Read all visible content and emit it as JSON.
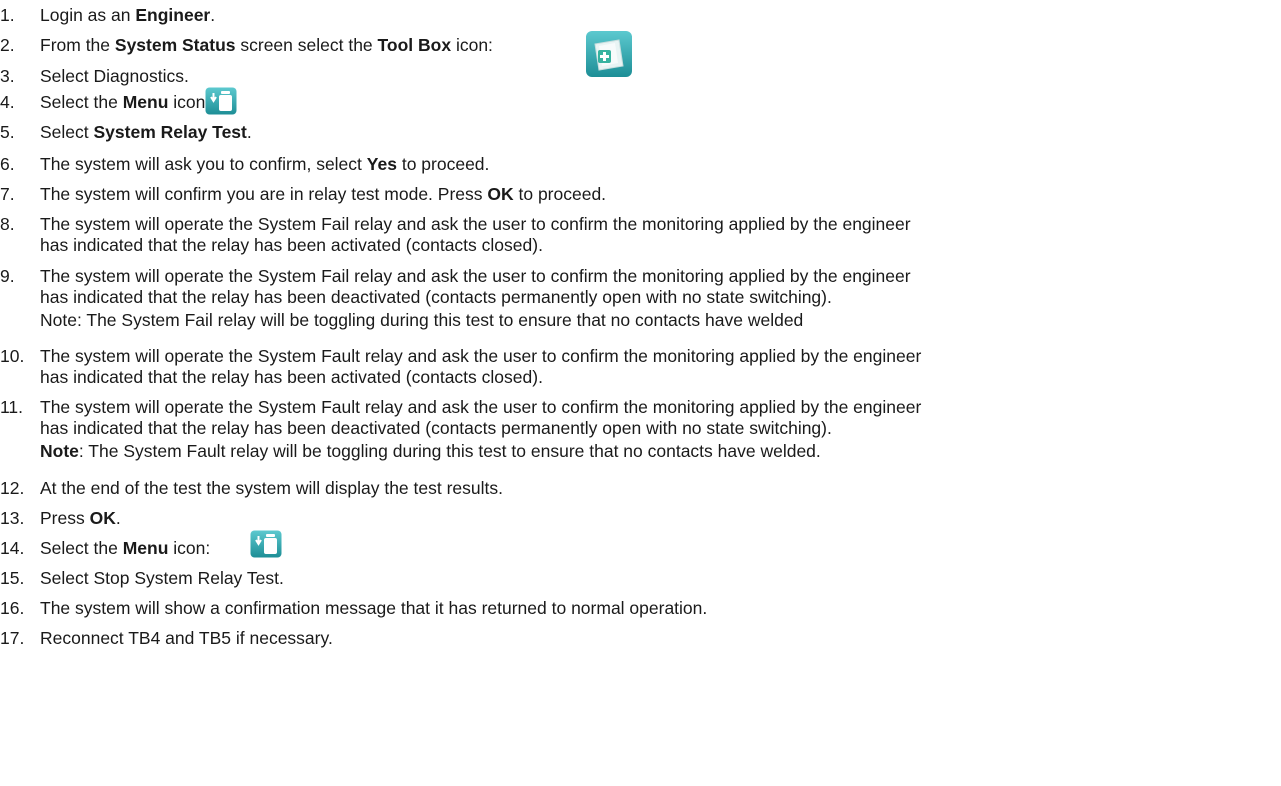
{
  "steps": [
    {
      "num": "1.",
      "parts": [
        {
          "t": "Login as an "
        },
        {
          "t": "Engineer",
          "b": true
        },
        {
          "t": "."
        }
      ]
    },
    {
      "num": "2.",
      "parts": [
        {
          "t": "From the "
        },
        {
          "t": "System Status",
          "b": true
        },
        {
          "t": " screen select the "
        },
        {
          "t": "Tool Box",
          "b": true
        },
        {
          "t": " icon:"
        }
      ],
      "icon": "toolbox-icon"
    },
    {
      "num": "3.",
      "parts": [
        {
          "t": "Select Diagnostics."
        }
      ]
    },
    {
      "num": "4.",
      "parts": [
        {
          "t": "Select the "
        },
        {
          "t": "Menu",
          "b": true
        },
        {
          "t": " icon:"
        }
      ],
      "icon": "menu-icon"
    },
    {
      "num": "5.",
      "parts": [
        {
          "t": "Select "
        },
        {
          "t": "System Relay Test",
          "b": true
        },
        {
          "t": "."
        }
      ]
    },
    {
      "num": "6.",
      "parts": [
        {
          "t": "The system will ask you to confirm, select "
        },
        {
          "t": "Yes",
          "b": true
        },
        {
          "t": " to proceed."
        }
      ]
    },
    {
      "num": "7.",
      "parts": [
        {
          "t": "The system will confirm you are in relay test mode. Press "
        },
        {
          "t": "OK",
          "b": true
        },
        {
          "t": " to proceed."
        }
      ]
    },
    {
      "num": "8.",
      "lines": [
        "The system will operate the System Fail relay and ask the user to confirm the monitoring applied by the engineer",
        "has indicated that the relay has been activated (contacts closed)."
      ]
    },
    {
      "num": "9.",
      "lines": [
        "The system will operate the System Fail relay and ask the user to confirm the monitoring applied by the engineer",
        "has indicated that the relay has been deactivated (contacts permanently open with no state switching)."
      ]
    },
    {
      "num": "10.",
      "lines": [
        "The system will operate the System Fault relay and ask the user to confirm the monitoring applied by the engineer",
        "has indicated that the relay has been activated (contacts closed)."
      ]
    },
    {
      "num": "11.",
      "lines": [
        "The system will operate the System Fault relay and ask the user to confirm the monitoring applied by the engineer",
        "has indicated that the relay has been deactivated (contacts permanently open with no state switching)."
      ]
    },
    {
      "num": "12.",
      "parts": [
        {
          "t": "At the end of the test the system will display the test results."
        }
      ]
    },
    {
      "num": "13.",
      "parts": [
        {
          "t": "Press "
        },
        {
          "t": "OK",
          "b": true
        },
        {
          "t": "."
        }
      ]
    },
    {
      "num": "14.",
      "parts": [
        {
          "t": "Select the "
        },
        {
          "t": "Menu",
          "b": true
        },
        {
          "t": " icon:"
        }
      ],
      "icon": "menu-icon"
    },
    {
      "num": "15.",
      "parts": [
        {
          "t": "Select Stop System Relay Test."
        }
      ]
    },
    {
      "num": "16.",
      "parts": [
        {
          "t": "The system will show a confirmation message that it has returned to normal operation."
        }
      ]
    },
    {
      "num": "17.",
      "parts": [
        {
          "t": "Reconnect TB4 and TB5 if necessary."
        }
      ]
    }
  ],
  "notes": {
    "note_fail": "Note: The System Fail relay will be toggling during this test to ensure that no contacts have welded",
    "note_fault_label": "Note",
    "note_fault_text": ": The System Fault relay will be toggling during this test to ensure that no contacts have welded."
  },
  "colors": {
    "icon_teal": "#2fb0b6",
    "icon_teal_dark": "#1d8e96"
  }
}
